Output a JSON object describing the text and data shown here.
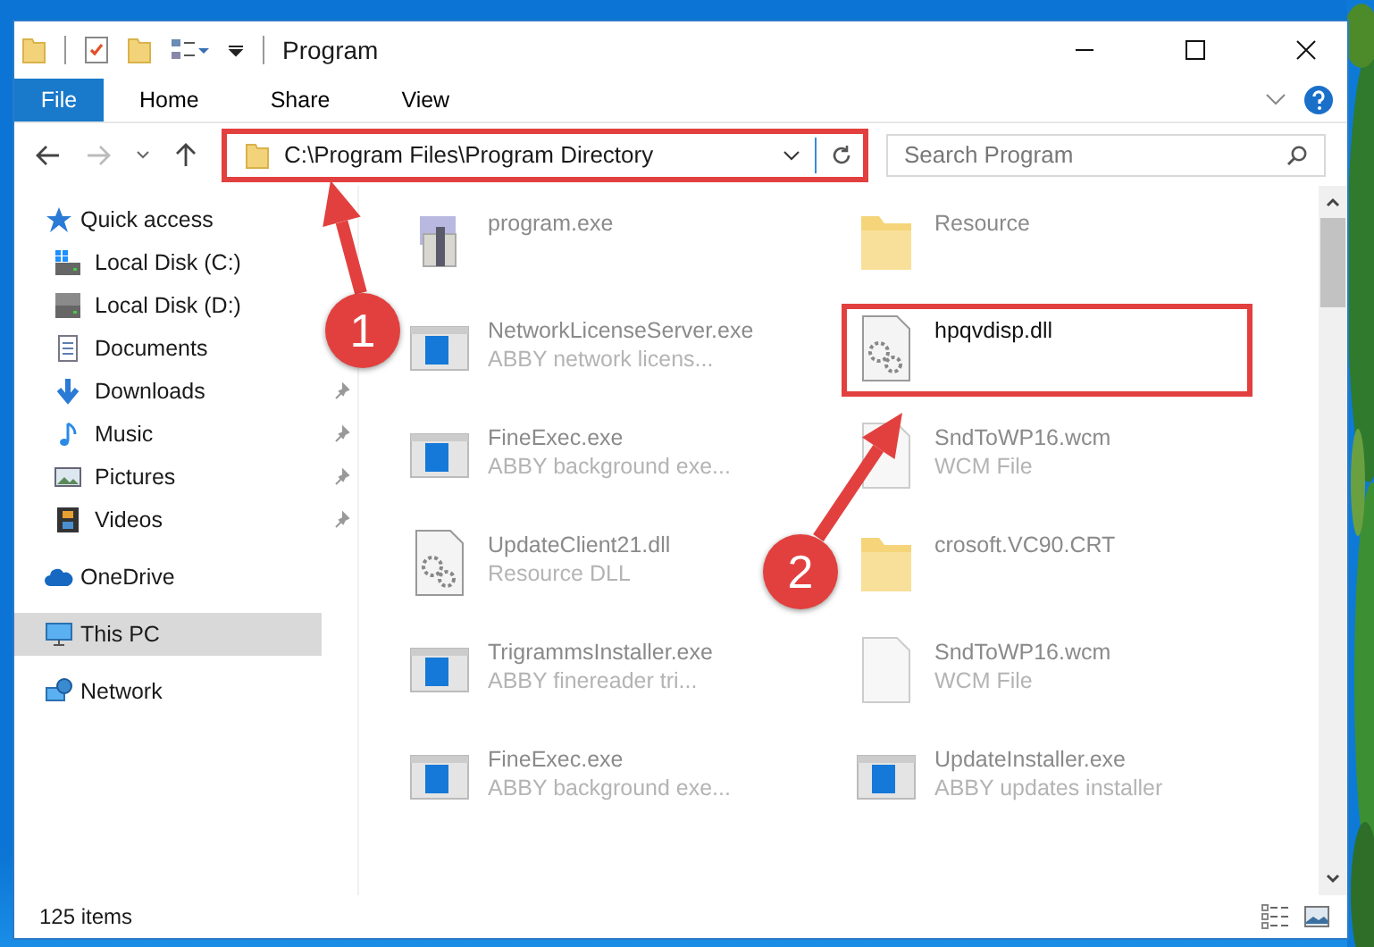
{
  "window": {
    "title": "Program"
  },
  "ribbon_tabs": [
    {
      "label": "File",
      "kind": "menu"
    },
    {
      "label": "Home",
      "kind": "tab"
    },
    {
      "label": "Share",
      "kind": "tab"
    },
    {
      "label": "View",
      "kind": "tab"
    }
  ],
  "address_bar": {
    "path": "C:\\Program Files\\Program Directory",
    "highlighted": true
  },
  "search": {
    "placeholder": "Search Program"
  },
  "sidebar": {
    "items": [
      {
        "label": "Quick access",
        "selected": false,
        "children": [
          {
            "label": "Local Disk (C:)",
            "pinned": false,
            "selected": false
          },
          {
            "label": "Local Disk (D:)",
            "pinned": false,
            "selected": false
          },
          {
            "label": "Documents",
            "pinned": false,
            "selected": false
          },
          {
            "label": "Downloads",
            "pinned": true,
            "selected": false
          },
          {
            "label": "Music",
            "pinned": true,
            "selected": false
          },
          {
            "label": "Pictures",
            "pinned": true,
            "selected": false
          },
          {
            "label": "Videos",
            "pinned": true,
            "selected": false
          }
        ]
      },
      {
        "label": "OneDrive",
        "selected": false
      },
      {
        "label": "This PC",
        "selected": true
      },
      {
        "label": "Network",
        "selected": false
      }
    ]
  },
  "files": [
    {
      "name": "program.exe",
      "kind": "setup",
      "focused": false
    },
    {
      "name": "Resource",
      "kind": "folder",
      "focused": false
    },
    {
      "name": "NetworkLicenseServer.exe",
      "description": "ABBY network licens...",
      "kind": "exe",
      "focused": false
    },
    {
      "name": "hpqvdisp.dll",
      "kind": "dll",
      "focused": true
    },
    {
      "name": "FineExec.exe",
      "description": "ABBY background exe...",
      "kind": "exe",
      "focused": false
    },
    {
      "name": "SndToWP16.wcm",
      "description": "WCM File",
      "kind": "file",
      "focused": false
    },
    {
      "name": "UpdateClient21.dll",
      "description": "Resource DLL",
      "kind": "dll",
      "focused": false
    },
    {
      "name": "crosoft.VC90.CRT",
      "kind": "folder",
      "focused": false
    },
    {
      "name": "TrigrammsInstaller.exe",
      "description": "ABBY finereader tri...",
      "kind": "exe",
      "focused": false
    },
    {
      "name": "SndToWP16.wcm",
      "description": "WCM File",
      "kind": "file",
      "focused": false
    },
    {
      "name": "FineExec.exe",
      "description": "ABBY background exe...",
      "kind": "exe",
      "focused": false
    },
    {
      "name": "UpdateInstaller.exe",
      "description": "ABBY updates installer",
      "kind": "exe",
      "focused": false
    }
  ],
  "status_bar": {
    "item_count": "125 items"
  },
  "annotations": [
    {
      "label": "1"
    },
    {
      "label": "2"
    }
  ]
}
